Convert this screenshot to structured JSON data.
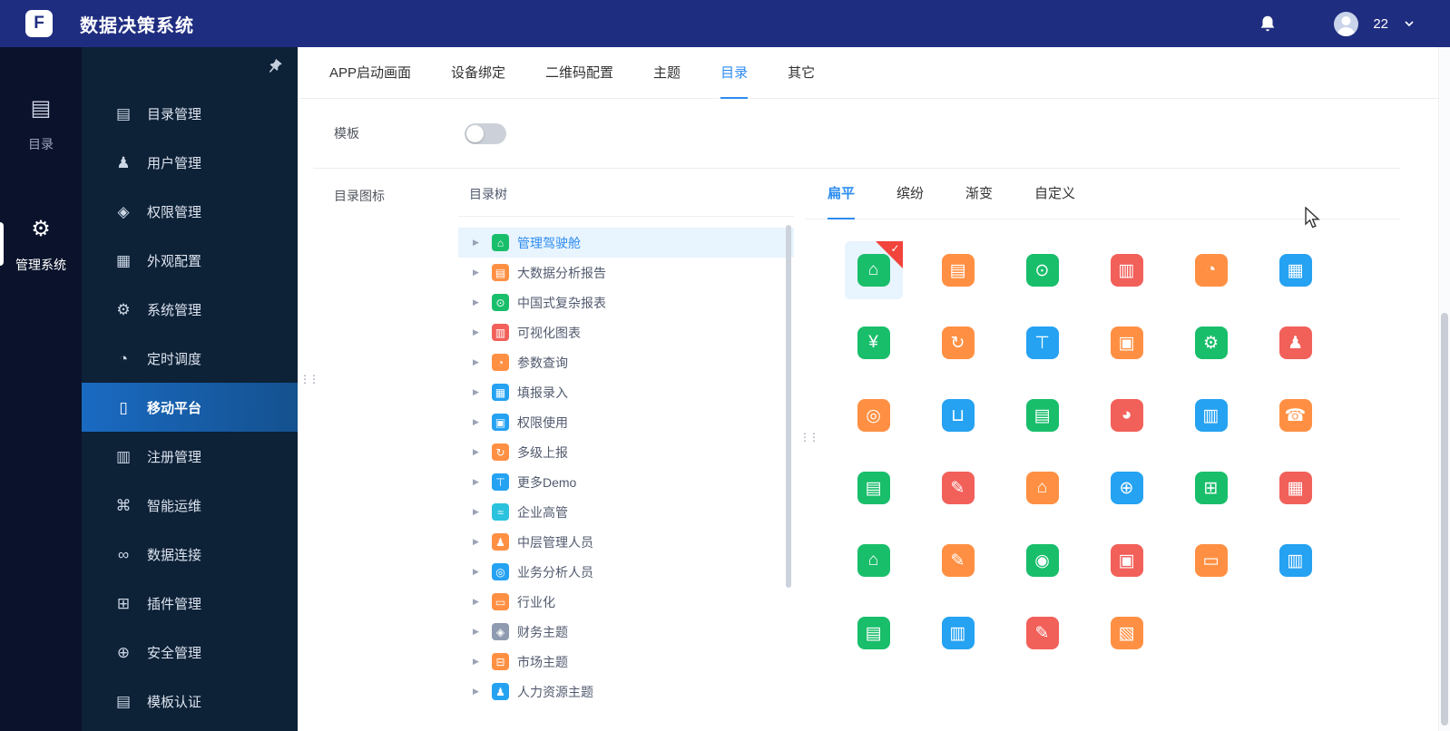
{
  "topbar": {
    "title": "数据决策系统",
    "logo_glyph": "F",
    "user": "22"
  },
  "rail": {
    "items": [
      {
        "label": "目录",
        "glyph": "▤",
        "active": false
      },
      {
        "label": "管理系统",
        "glyph": "⚙",
        "active": true
      }
    ]
  },
  "sidebar": {
    "items": [
      {
        "label": "目录管理",
        "glyph": "▤"
      },
      {
        "label": "用户管理",
        "glyph": "♟"
      },
      {
        "label": "权限管理",
        "glyph": "◈"
      },
      {
        "label": "外观配置",
        "glyph": "▦"
      },
      {
        "label": "系统管理",
        "glyph": "⚙"
      },
      {
        "label": "定时调度",
        "glyph": "◔"
      },
      {
        "label": "移动平台",
        "glyph": "▯",
        "active": true
      },
      {
        "label": "注册管理",
        "glyph": "▥"
      },
      {
        "label": "智能运维",
        "glyph": "⌘"
      },
      {
        "label": "数据连接",
        "glyph": "∞"
      },
      {
        "label": "插件管理",
        "glyph": "⊞"
      },
      {
        "label": "安全管理",
        "glyph": "⊕"
      },
      {
        "label": "模板认证",
        "glyph": "▤"
      }
    ]
  },
  "main": {
    "tabs": [
      {
        "label": "APP启动画面"
      },
      {
        "label": "设备绑定"
      },
      {
        "label": "二维码配置"
      },
      {
        "label": "主题"
      },
      {
        "label": "目录",
        "active": true
      },
      {
        "label": "其它"
      }
    ],
    "form": {
      "template_label": "模板",
      "toggle_on": false,
      "icon_label": "目录图标"
    },
    "selected_check": "✓",
    "tree": {
      "header": "目录树",
      "expand_glyph": "▶",
      "items": [
        {
          "label": "管理驾驶舱",
          "glyph": "⌂",
          "color": "#19be6b",
          "active": true
        },
        {
          "label": "大数据分析报告",
          "glyph": "▤",
          "color": "#ff9043"
        },
        {
          "label": "中国式复杂报表",
          "glyph": "⊙",
          "color": "#19be6b"
        },
        {
          "label": "可视化图表",
          "glyph": "▥",
          "color": "#f2605a"
        },
        {
          "label": "参数查询",
          "glyph": "◔",
          "color": "#ff9043"
        },
        {
          "label": "填报录入",
          "glyph": "▦",
          "color": "#25a2f2"
        },
        {
          "label": "权限使用",
          "glyph": "▣",
          "color": "#25a2f2"
        },
        {
          "label": "多级上报",
          "glyph": "↻",
          "color": "#ff9043"
        },
        {
          "label": "更多Demo",
          "glyph": "⊤",
          "color": "#25a2f2"
        },
        {
          "label": "企业高管",
          "glyph": "≈",
          "color": "#2bc2de"
        },
        {
          "label": "中层管理人员",
          "glyph": "♟",
          "color": "#ff9043"
        },
        {
          "label": "业务分析人员",
          "glyph": "◎",
          "color": "#25a2f2"
        },
        {
          "label": "行业化",
          "glyph": "▭",
          "color": "#ff9043"
        },
        {
          "label": "财务主题",
          "glyph": "◈",
          "color": "#8f9bb0"
        },
        {
          "label": "市场主题",
          "glyph": "⊟",
          "color": "#ff9043"
        },
        {
          "label": "人力资源主题",
          "glyph": "♟",
          "color": "#25a2f2"
        }
      ]
    },
    "icon_tabs": [
      {
        "label": "扁平",
        "active": true
      },
      {
        "label": "缤纷"
      },
      {
        "label": "渐变"
      },
      {
        "label": "自定义"
      }
    ],
    "icon_grid": [
      {
        "glyph": "⌂",
        "color": "#19be6b",
        "active": true
      },
      {
        "glyph": "▤",
        "color": "#ff9043"
      },
      {
        "glyph": "⊙",
        "color": "#19be6b"
      },
      {
        "glyph": "▥",
        "color": "#f2605a"
      },
      {
        "glyph": "◔",
        "color": "#ff9043"
      },
      {
        "glyph": "▦",
        "color": "#25a2f2"
      },
      {
        "glyph": "¥",
        "color": "#19be6b"
      },
      {
        "glyph": "↻",
        "color": "#ff9043"
      },
      {
        "glyph": "⊤",
        "color": "#25a2f2"
      },
      {
        "glyph": "▣",
        "color": "#ff9043"
      },
      {
        "glyph": "⚙",
        "color": "#19be6b"
      },
      {
        "glyph": "♟",
        "color": "#f2605a"
      },
      {
        "glyph": "◎",
        "color": "#ff9043"
      },
      {
        "glyph": "⊔",
        "color": "#25a2f2"
      },
      {
        "glyph": "▤",
        "color": "#19be6b"
      },
      {
        "glyph": "◕",
        "color": "#f2605a"
      },
      {
        "glyph": "▥",
        "color": "#25a2f2"
      },
      {
        "glyph": "☎",
        "color": "#ff9043"
      },
      {
        "glyph": "▤",
        "color": "#19be6b"
      },
      {
        "glyph": "✎",
        "color": "#f2605a"
      },
      {
        "glyph": "⌂",
        "color": "#ff9043"
      },
      {
        "glyph": "⊕",
        "color": "#25a2f2"
      },
      {
        "glyph": "⊞",
        "color": "#19be6b"
      },
      {
        "glyph": "▦",
        "color": "#f2605a"
      },
      {
        "glyph": "⌂",
        "color": "#19be6b"
      },
      {
        "glyph": "✎",
        "color": "#ff9043"
      },
      {
        "glyph": "◉",
        "color": "#19be6b"
      },
      {
        "glyph": "▣",
        "color": "#f2605a"
      },
      {
        "glyph": "▭",
        "color": "#ff9043"
      },
      {
        "glyph": "▥",
        "color": "#25a2f2"
      },
      {
        "glyph": "▤",
        "color": "#19be6b"
      },
      {
        "glyph": "▥",
        "color": "#25a2f2"
      },
      {
        "glyph": "✎",
        "color": "#f2605a"
      },
      {
        "glyph": "▧",
        "color": "#ff9043"
      }
    ]
  }
}
